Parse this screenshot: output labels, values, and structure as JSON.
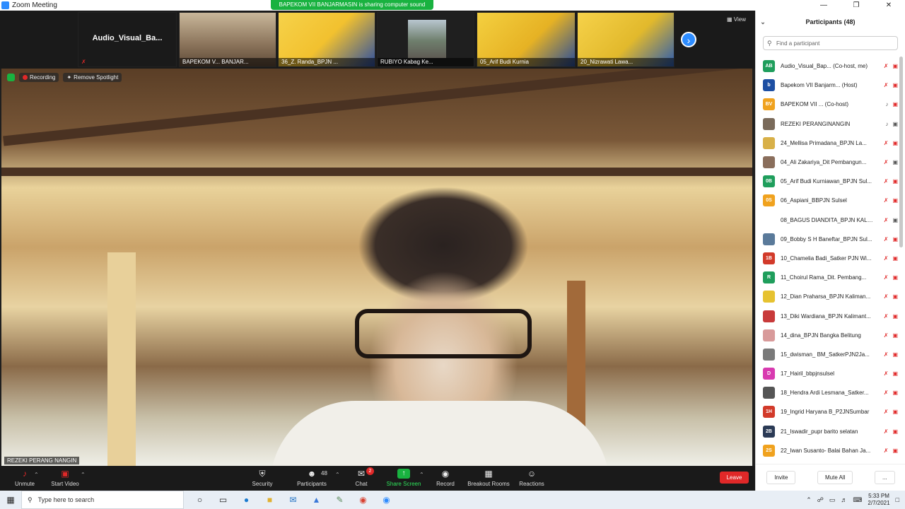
{
  "window": {
    "title": "Zoom Meeting"
  },
  "share_banner": "BAPEKOM VII BANJARMASIN is sharing computer sound",
  "strip": {
    "tiles": [
      {
        "name": "Audio_Visual_Ba...",
        "label": ""
      },
      {
        "name": "",
        "label": "BAPEKOM V... BANJAR..."
      },
      {
        "name": "",
        "label": "36_Z. Randa_BPJN ..."
      },
      {
        "name": "",
        "label": "RUBIYO Kabag Ke..."
      },
      {
        "name": "",
        "label": "05_Arif Budi Kurnia"
      },
      {
        "name": "",
        "label": "20_Nizrawati Lawa..."
      }
    ],
    "view_label": "View"
  },
  "main_video": {
    "recording_label": "Recording",
    "remove_spotlight_label": "Remove Spotlight",
    "speaker_name": "REZEKI PERANG NANGIN"
  },
  "toolbar": {
    "unmute": "Unmute",
    "start_video": "Start Video",
    "security": "Security",
    "participants": "Participants",
    "participants_count": "48",
    "chat": "Chat",
    "chat_badge": "2",
    "share_screen": "Share Screen",
    "record": "Record",
    "breakout_rooms": "Breakout Rooms",
    "reactions": "Reactions",
    "leave": "Leave"
  },
  "panel": {
    "title": "Participants (48)",
    "search_placeholder": "Find a participant",
    "participants": [
      {
        "initials": "AB",
        "color": "#1f9e5c",
        "name": "Audio_Visual_Bap... (Co-host, me)"
      },
      {
        "initials": "b",
        "color": "#1d4fa3",
        "name": "Bapekom VII Banjarm... (Host)"
      },
      {
        "initials": "BV",
        "color": "#f0a21e",
        "name": "BAPEKOM VII ... (Co-host)"
      },
      {
        "initials": "",
        "color": "#7a6a5a",
        "name": "REZEKI PERANGINANGIN"
      },
      {
        "initials": "",
        "color": "#d8b048",
        "name": "24_Mellisa Primadana_BPJN La..."
      },
      {
        "initials": "",
        "color": "#8a6e5c",
        "name": "04_Ali Zakariya_Dit Pembangun..."
      },
      {
        "initials": "0B",
        "color": "#1f9e5c",
        "name": "05_Arif Budi Kurniawan_BPJN Sul..."
      },
      {
        "initials": "0S",
        "color": "#f0a21e",
        "name": "06_Aspiani_BBPJN Sulsel"
      },
      {
        "initials": "",
        "color": "#ffffff",
        "name": "08_BAGUS DIANDITA_BPJN KALB..."
      },
      {
        "initials": "",
        "color": "#5a7a9a",
        "name": "09_Bobby S H Baneftar_BPJN Sul..."
      },
      {
        "initials": "1B",
        "color": "#d23a2a",
        "name": "10_Chamelia Badi_Satker PJN Wi..."
      },
      {
        "initials": "R",
        "color": "#1f9e5c",
        "name": "11_Choirul Rama_Dit. Pembang..."
      },
      {
        "initials": "",
        "color": "#e6c230",
        "name": "12_Dian Praharsa_BPJN Kaliman..."
      },
      {
        "initials": "",
        "color": "#c83a3a",
        "name": "13_Diki Wardiana_BPJN Kalimant..."
      },
      {
        "initials": "",
        "color": "#d89a9a",
        "name": "14_dina_BPJN Bangka Belitung"
      },
      {
        "initials": "",
        "color": "#7a7a7a",
        "name": "15_dwisman_ BM_SatkerPJN2Ja..."
      },
      {
        "initials": "D",
        "color": "#d83ab0",
        "name": "17_Hairil_bbpjnsulsel"
      },
      {
        "initials": "",
        "color": "#555555",
        "name": "18_Hendra Ardi Lesmana_Satker..."
      },
      {
        "initials": "1H",
        "color": "#d23a2a",
        "name": "19_Ingrid Haryana B_P2JNSumbar"
      },
      {
        "initials": "2B",
        "color": "#2b3a55",
        "name": "21_Iswadir_pupr barito selatan"
      },
      {
        "initials": "2S",
        "color": "#f0a21e",
        "name": "22_Iwan Susanto- Balai Bahan Ja..."
      }
    ],
    "invite": "Invite",
    "mute_all": "Mute All",
    "more": "..."
  },
  "taskbar": {
    "search_placeholder": "Type here to search",
    "time": "5:33 PM",
    "date": "2/7/2021"
  }
}
